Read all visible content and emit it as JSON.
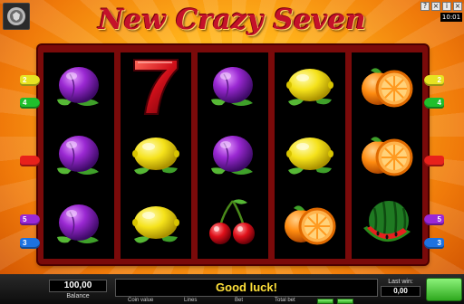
{
  "game": {
    "title": "New Crazy Seven",
    "clock": "10:01",
    "window_controls": [
      "?",
      "×",
      "i",
      "×"
    ]
  },
  "reels": [
    [
      "plum",
      "plum",
      "plum"
    ],
    [
      "seven",
      "lemon",
      "lemon"
    ],
    [
      "plum",
      "plum",
      "cherry"
    ],
    [
      "lemon",
      "lemon",
      "orange"
    ],
    [
      "orange",
      "orange",
      "watermelon"
    ]
  ],
  "line_markers": {
    "left": [
      {
        "label": "2",
        "color": "#e7e322"
      },
      {
        "label": "4",
        "color": "#1fbf2c"
      },
      {
        "label": "",
        "color": "#e8211b"
      },
      {
        "label": "5",
        "color": "#9a27d8"
      },
      {
        "label": "3",
        "color": "#1e72e0"
      }
    ],
    "right": [
      {
        "label": "2",
        "color": "#e7e322"
      },
      {
        "label": "4",
        "color": "#1fbf2c"
      },
      {
        "label": "",
        "color": "#e8211b"
      },
      {
        "label": "5",
        "color": "#9a27d8"
      },
      {
        "label": "3",
        "color": "#1e72e0"
      }
    ]
  },
  "bottom": {
    "balance_value": "100,00",
    "balance_label": "Balance",
    "message": "Good luck!",
    "last_win_label": "Last win:",
    "last_win_value": "0,00",
    "stat_labels": [
      "Coin value",
      "Lines",
      "Bet",
      "Total bet"
    ]
  },
  "colors": {
    "title": "#c4122a",
    "message": "#ffe13a",
    "reel_background": "#000000",
    "frame": "#7a0a0a",
    "spin_green": "#2ea81e"
  }
}
